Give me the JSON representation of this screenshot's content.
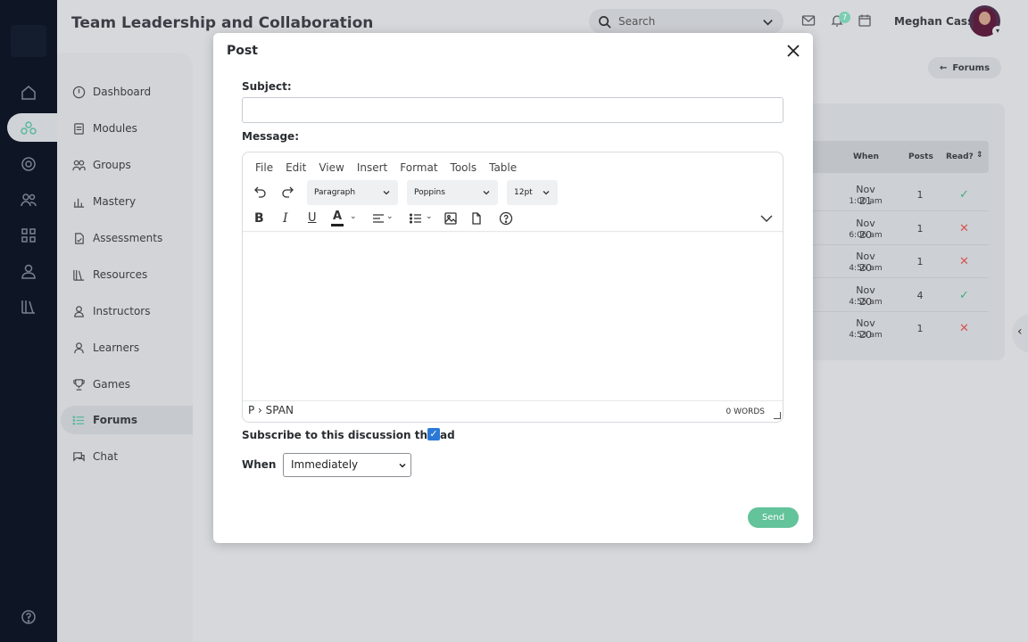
{
  "page": {
    "title": "Team Leadership and Collaboration"
  },
  "topbar": {
    "search_placeholder": "Search",
    "notification_count": "7",
    "user_name": "Meghan Cass"
  },
  "nav": {
    "items": [
      {
        "label": "Dashboard",
        "icon": "dashboard-icon"
      },
      {
        "label": "Modules",
        "icon": "modules-icon"
      },
      {
        "label": "Groups",
        "icon": "groups-icon"
      },
      {
        "label": "Mastery",
        "icon": "mastery-icon"
      },
      {
        "label": "Assessments",
        "icon": "assessments-icon"
      },
      {
        "label": "Resources",
        "icon": "resources-icon"
      },
      {
        "label": "Instructors",
        "icon": "instructors-icon"
      },
      {
        "label": "Learners",
        "icon": "learners-icon"
      },
      {
        "label": "Games",
        "icon": "games-icon"
      },
      {
        "label": "Forums",
        "icon": "forums-icon",
        "active": true
      },
      {
        "label": "Chat",
        "icon": "chat-icon"
      }
    ]
  },
  "forums_button": {
    "label": "Forums"
  },
  "table": {
    "headers": [
      "When",
      "Posts",
      "Read?"
    ],
    "rows": [
      {
        "date": "Nov 21",
        "time": "1:00 am",
        "posts": "1",
        "read": "✓"
      },
      {
        "date": "Nov 20",
        "time": "6:06 am",
        "posts": "1",
        "read": "✕"
      },
      {
        "date": "Nov 20",
        "time": "4:56 am",
        "posts": "1",
        "read": "✕"
      },
      {
        "date": "Nov 20",
        "time": "4:55 am",
        "posts": "4",
        "read": "✓"
      },
      {
        "date": "Nov 20",
        "time": "4:53 am",
        "posts": "1",
        "read": "✕"
      }
    ]
  },
  "modal": {
    "title": "Post",
    "subject_label": "Subject:",
    "subject_value": "",
    "message_label": "Message:",
    "editor": {
      "menu": [
        "File",
        "Edit",
        "View",
        "Insert",
        "Format",
        "Tools",
        "Table"
      ],
      "block_format": "Paragraph",
      "font_family": "Poppins",
      "font_size": "12pt",
      "path": "P › SPAN",
      "word_count": "0 WORDS"
    },
    "subscribe_label": "Subscribe to this discussion thread",
    "subscribe_checked": true,
    "when_label": "When",
    "when_value": "Immediately",
    "send_label": "Send"
  },
  "colors": {
    "accent": "#63c39a",
    "checkbox": "#2b79d7",
    "sidebar_rail": "#0e1626",
    "read_yes": "#3fae7c",
    "read_no": "#d9534f"
  }
}
